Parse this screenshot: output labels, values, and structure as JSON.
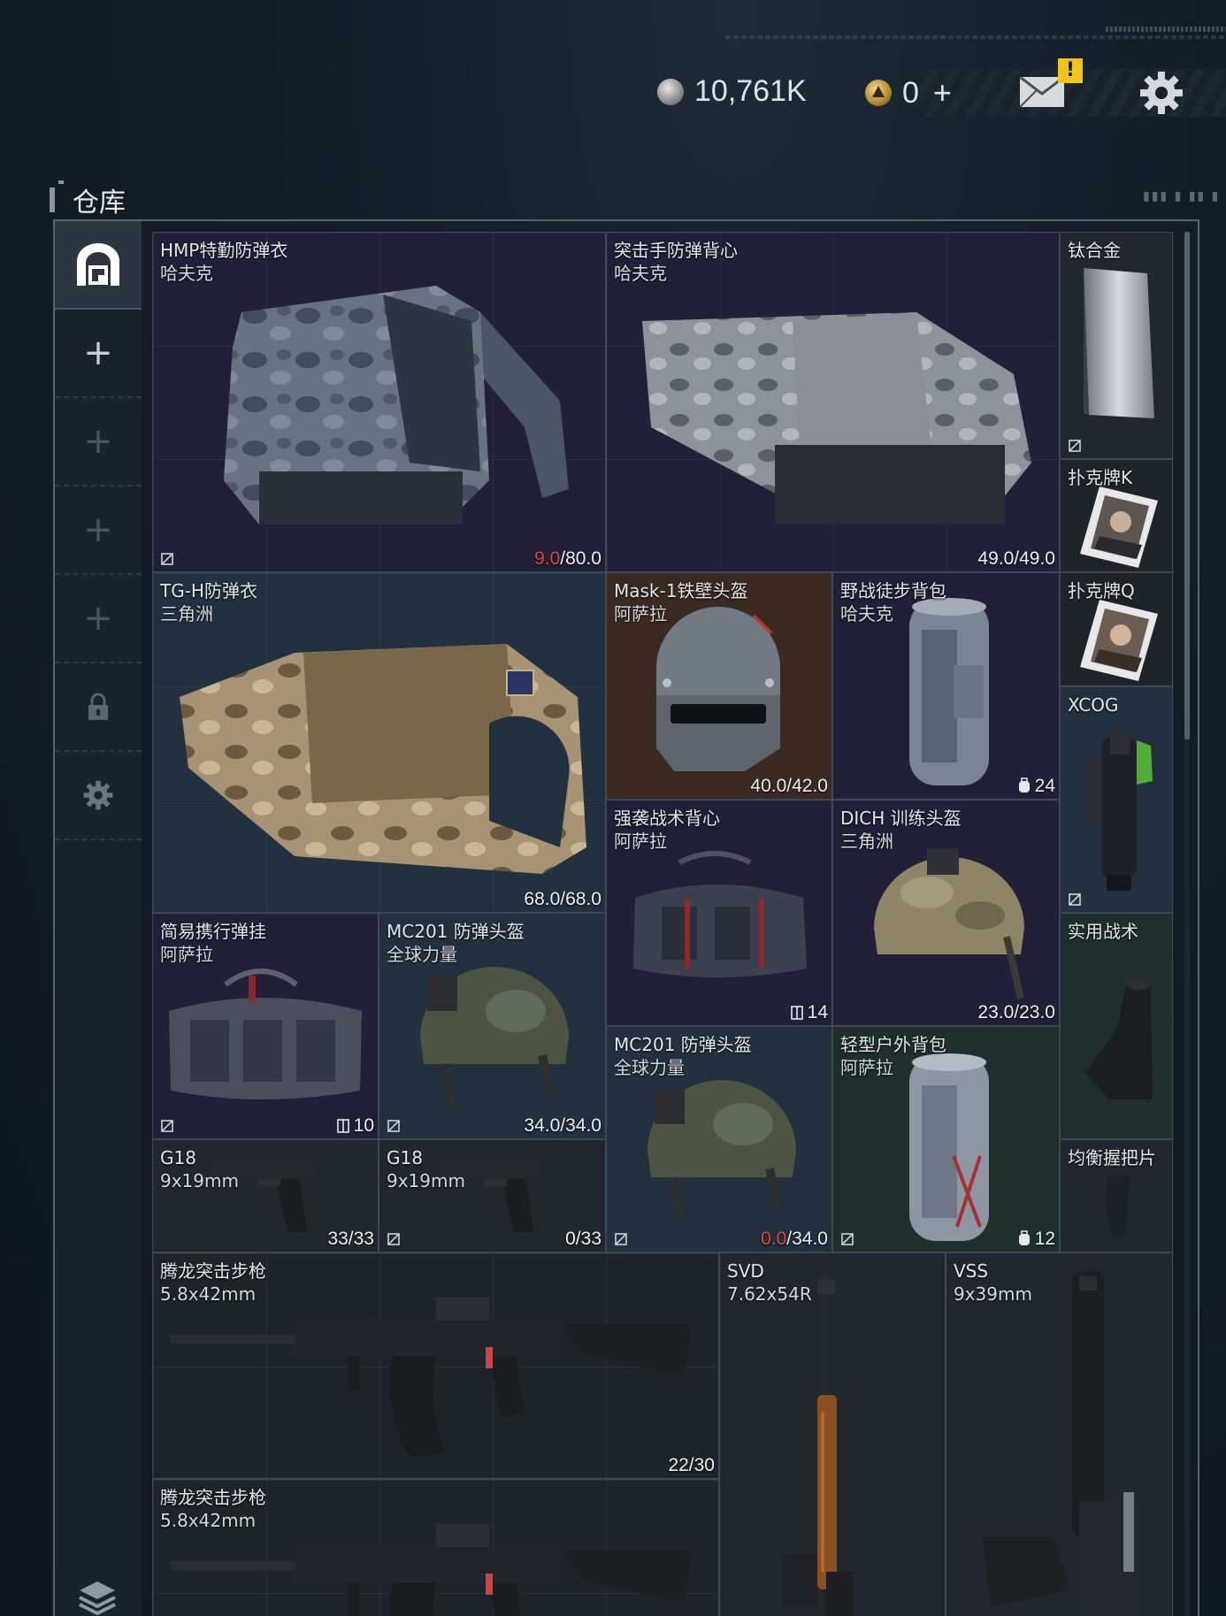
{
  "header": {
    "currency_silver": "10,761K",
    "currency_gold": "0",
    "plus_label": "+",
    "mail_badge": "!",
    "accent_colors": {
      "badge": "#f0c51a",
      "red_value": "#e5443c"
    }
  },
  "section": {
    "title": "仓库"
  },
  "sidebar": {
    "items": [
      {
        "icon": "warehouse-icon",
        "label": ""
      },
      {
        "icon": "plus-icon",
        "label": "+"
      },
      {
        "icon": "plus-icon",
        "label": "+"
      },
      {
        "icon": "plus-icon",
        "label": "+"
      },
      {
        "icon": "plus-icon",
        "label": "+"
      },
      {
        "icon": "lock-icon",
        "label": ""
      },
      {
        "icon": "gear-icon",
        "label": ""
      },
      {
        "icon": "layers-icon",
        "label": ""
      }
    ]
  },
  "items": [
    {
      "name": "HMP特勤防弹衣",
      "sub": "哈夫克",
      "value_red": "9.0",
      "value": "/80.0",
      "icon": "armor-vest-icon"
    },
    {
      "name": "突击手防弹背心",
      "sub": "哈夫克",
      "value_red": "",
      "value": "49.0/49.0",
      "icon": "armor-vest-icon"
    },
    {
      "name": "钛合金",
      "sub": "",
      "value_red": "",
      "value": "",
      "icon": "metal-plate-icon"
    },
    {
      "name": "扑克牌K",
      "sub": "",
      "value_red": "",
      "value": "",
      "icon": "playing-card-icon"
    },
    {
      "name": "TG-H防弹衣",
      "sub": "三角洲",
      "value_red": "",
      "value": "68.0/68.0",
      "icon": "armor-vest-icon"
    },
    {
      "name": "Mask-1铁壁头盔",
      "sub": "阿萨拉",
      "value_red": "",
      "value": "40.0/42.0",
      "icon": "helmet-icon"
    },
    {
      "name": "野战徒步背包",
      "sub": "哈夫克",
      "value_red": "",
      "value": "24",
      "icon": "backpack-icon"
    },
    {
      "name": "扑克牌Q",
      "sub": "",
      "value_red": "",
      "value": "",
      "icon": "playing-card-icon"
    },
    {
      "name": "XCOG",
      "sub": "",
      "value_red": "",
      "value": "",
      "icon": "scope-icon"
    },
    {
      "name": "强袭战术背心",
      "sub": "阿萨拉",
      "value_red": "",
      "value": "14",
      "icon": "chest-rig-icon"
    },
    {
      "name": "DICH 训练头盔",
      "sub": "三角洲",
      "value_red": "",
      "value": "23.0/23.0",
      "icon": "helmet-icon"
    },
    {
      "name": "简易携行弹挂",
      "sub": "阿萨拉",
      "value_red": "",
      "value": "10",
      "icon": "chest-rig-icon"
    },
    {
      "name": "MC201 防弹头盔",
      "sub": "全球力量",
      "value_red": "",
      "value": "34.0/34.0",
      "icon": "helmet-icon"
    },
    {
      "name": "实用战术",
      "sub": "",
      "value_red": "",
      "value": "",
      "icon": "stock-icon"
    },
    {
      "name": "MC201 防弹头盔",
      "sub": "全球力量",
      "value_red": "0.0",
      "value": "/34.0",
      "icon": "helmet-icon"
    },
    {
      "name": "轻型户外背包",
      "sub": "阿萨拉",
      "value_red": "",
      "value": "12",
      "icon": "backpack-icon"
    },
    {
      "name": "G18",
      "sub": "9x19mm",
      "value_red": "",
      "value": "33/33",
      "icon": "pistol-icon"
    },
    {
      "name": "G18",
      "sub": "9x19mm",
      "value_red": "",
      "value": "0/33",
      "icon": "pistol-icon"
    },
    {
      "name": "均衡握把片",
      "sub": "",
      "value_red": "",
      "value": "",
      "icon": "grip-icon"
    },
    {
      "name": "腾龙突击步枪",
      "sub": "5.8x42mm",
      "value_red": "",
      "value": "22/30",
      "icon": "rifle-icon"
    },
    {
      "name": "SVD",
      "sub": "7.62x54R",
      "value_red": "",
      "value": "",
      "icon": "rifle-icon"
    },
    {
      "name": "VSS",
      "sub": "9x39mm",
      "value_red": "",
      "value": "",
      "icon": "rifle-icon"
    },
    {
      "name": "腾龙突击步枪",
      "sub": "5.8x42mm",
      "value_red": "",
      "value": "",
      "icon": "rifle-icon"
    }
  ]
}
